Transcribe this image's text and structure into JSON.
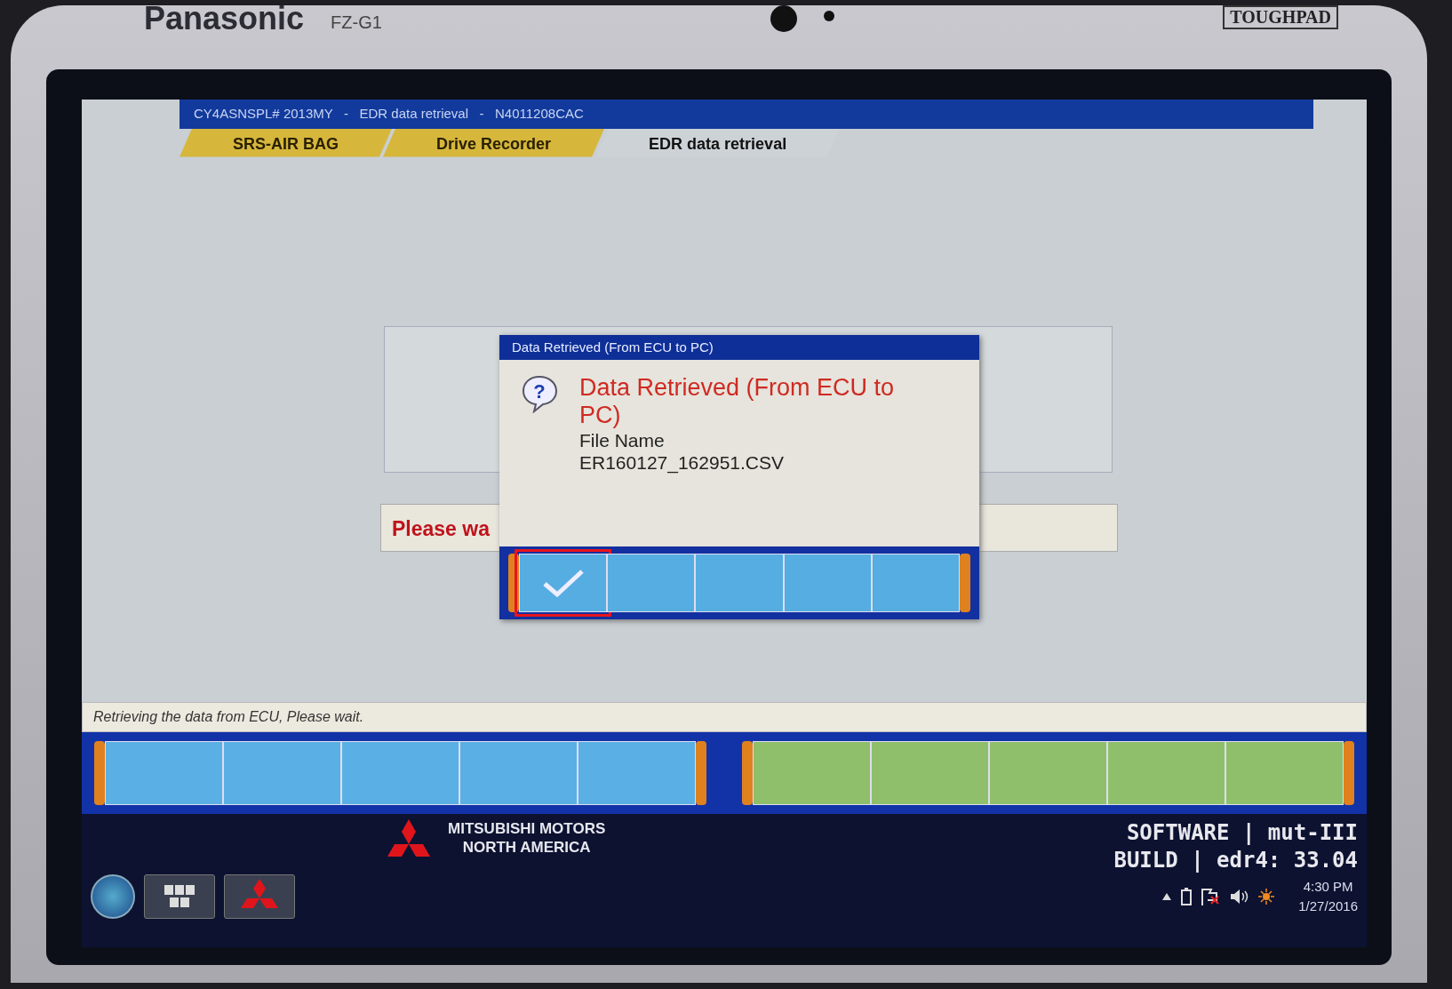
{
  "device": {
    "brand": "Panasonic",
    "model": "FZ-G1",
    "badge": "TOUGHPAD"
  },
  "title_bar": "CY4ASNSPL# 2013MY   -   EDR data retrieval   -   N4011208CAC",
  "tabs": [
    {
      "label": "SRS-AIR BAG",
      "selected": false
    },
    {
      "label": "Drive Recorder",
      "selected": false
    },
    {
      "label": "EDR data retrieval",
      "selected": true
    }
  ],
  "message_bar": "Please wa",
  "dialog": {
    "icon_glyph": "?",
    "title": "Data Retrieved (From ECU to PC)",
    "heading": "Data Retrieved (From ECU to PC)",
    "lines": [
      "File Name",
      "ER160127_162951.CSV"
    ],
    "keys": [
      {
        "kind": "check",
        "highlighted": true
      },
      {
        "kind": "blank",
        "highlighted": false
      },
      {
        "kind": "blank",
        "highlighted": false
      },
      {
        "kind": "blank",
        "highlighted": false
      },
      {
        "kind": "blank",
        "highlighted": false
      }
    ]
  },
  "status": "Retrieving the data from ECU, Please wait.",
  "key_groups": [
    {
      "color": "#5ab0e4",
      "keys": [
        {
          "kind": "blank"
        },
        {
          "kind": "blank"
        },
        {
          "kind": "blank"
        },
        {
          "kind": "blank"
        },
        {
          "kind": "blank"
        }
      ]
    },
    {
      "color": "#8fbf6a",
      "keys": [
        {
          "kind": "blank"
        },
        {
          "kind": "blank"
        },
        {
          "kind": "blank"
        },
        {
          "kind": "blank"
        },
        {
          "kind": "blank"
        }
      ]
    }
  ],
  "footer": {
    "logo_lines": [
      "MITSUBISHI MOTORS",
      "NORTH AMERICA"
    ],
    "software_lines": [
      "SOFTWARE | mut-III",
      "BUILD | edr4: 33.04"
    ]
  },
  "taskbar": {
    "buttons": [
      {
        "kind": "keyboard"
      },
      {
        "kind": "logo"
      }
    ],
    "tray": [
      {
        "kind": "arrow"
      },
      {
        "kind": "battery"
      },
      {
        "kind": "flag"
      },
      {
        "kind": "speaker"
      },
      {
        "kind": "sun"
      }
    ],
    "time": "4:30 PM",
    "date": "1/27/2016"
  }
}
